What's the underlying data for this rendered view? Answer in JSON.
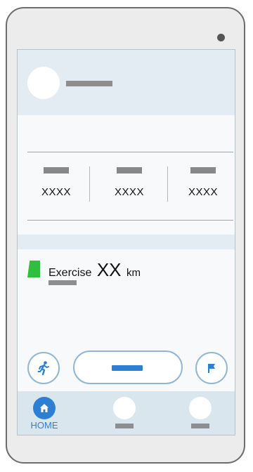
{
  "exercise": {
    "label": "Exercise",
    "value": "XX",
    "unit": "km"
  },
  "stats": [
    {
      "value": "XXXX"
    },
    {
      "value": "XXXX"
    },
    {
      "value": "XXXX"
    }
  ],
  "nav": {
    "home_label": "HOME"
  },
  "colors": {
    "accent": "#2d7fd3",
    "header_bg": "#e2ecf2",
    "nav_bg": "#d9e6ee",
    "marker_green": "#2fbf3f",
    "button_border": "#8fb6d6"
  },
  "icons": {
    "left_action": "running-person-icon",
    "right_action": "flag-icon",
    "nav_home": "home-icon"
  }
}
